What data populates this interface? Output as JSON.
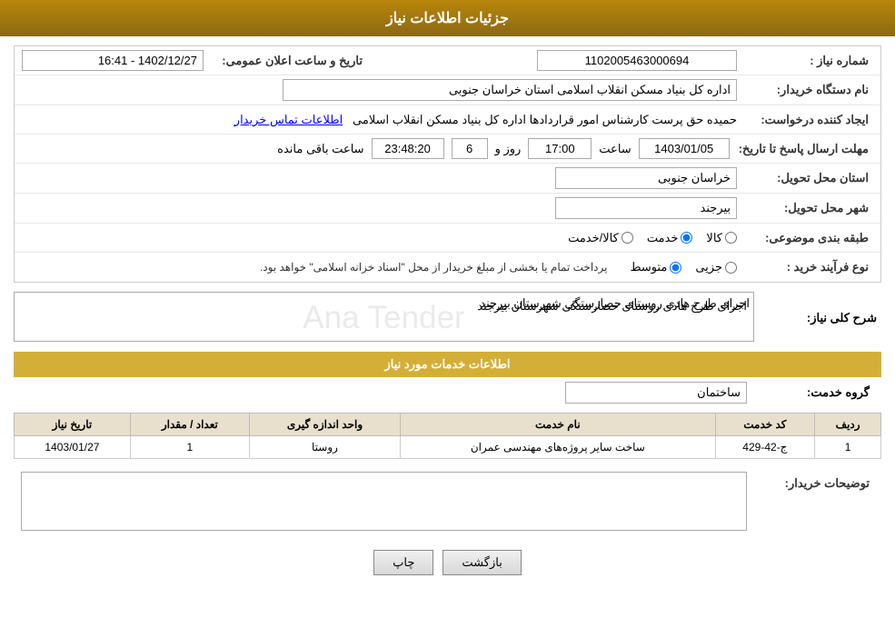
{
  "header": {
    "title": "جزئیات اطلاعات نیاز"
  },
  "fields": {
    "need_number_label": "شماره نیاز :",
    "need_number_value": "1102005463000694",
    "buyer_org_label": "نام دستگاه خریدار:",
    "buyer_org_value": "اداره کل بنیاد مسکن انقلاب اسلامی استان خراسان جنوبی",
    "creator_label": "ایجاد کننده درخواست:",
    "creator_value": "حمیده حق پرست کارشناس امور قراردادها اداره کل بنیاد مسکن انقلاب اسلامی",
    "creator_link": "اطلاعات تماس خریدار",
    "deadline_label": "مهلت ارسال پاسخ تا تاریخ:",
    "deadline_date": "1403/01/05",
    "deadline_time_label": "ساعت",
    "deadline_time": "17:00",
    "deadline_day_label": "روز و",
    "deadline_days": "6",
    "deadline_remaining_label": "ساعت باقی مانده",
    "deadline_remaining": "23:48:20",
    "announcement_label": "تاریخ و ساعت اعلان عمومی:",
    "announcement_value": "1402/12/27 - 16:41",
    "province_label": "استان محل تحویل:",
    "province_value": "خراسان جنوبی",
    "city_label": "شهر محل تحویل:",
    "city_value": "بیرجند",
    "category_label": "طبقه بندی موضوعی:",
    "category_options": [
      "کالا",
      "خدمت",
      "کالا/خدمت"
    ],
    "category_selected": "خدمت",
    "purchase_type_label": "نوع فرآیند خرید :",
    "purchase_type_options": [
      "جزیی",
      "متوسط"
    ],
    "purchase_type_note": "پرداخت تمام یا بخشی از مبلغ خریدار از محل \"اسناد خزانه اسلامی\" خواهد بود.",
    "description_label": "شرح کلی نیاز:",
    "description_value": "اجرای طرح هادی روستای حصارستگی شهرستان بیرجند",
    "services_title": "اطلاعات خدمات مورد نیاز",
    "service_group_label": "گروه خدمت:",
    "service_group_value": "ساختمان",
    "table": {
      "headers": [
        "ردیف",
        "کد خدمت",
        "نام خدمت",
        "واحد اندازه گیری",
        "تعداد / مقدار",
        "تاریخ نیاز"
      ],
      "rows": [
        [
          "1",
          "ج-42-429",
          "ساخت سایر پروژه‌های مهندسی عمران",
          "روستا",
          "1",
          "1403/01/27"
        ]
      ]
    },
    "buyer_desc_label": "توضیحات خریدار:",
    "buyer_desc_value": ""
  },
  "buttons": {
    "print": "چاپ",
    "back": "بازگشت"
  }
}
